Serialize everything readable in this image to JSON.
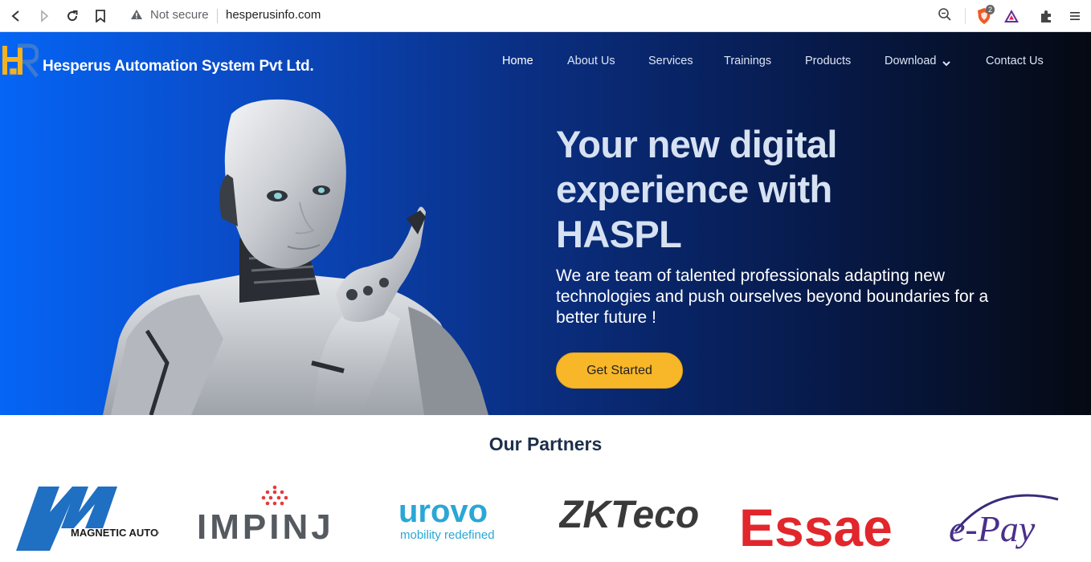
{
  "browser": {
    "security_label": "Not secure",
    "url": "hesperusinfo.com",
    "shield_badge": "2",
    "icons": [
      "back-icon",
      "forward-icon",
      "reload-icon",
      "bookmark-icon",
      "warning-icon",
      "zoom-icon",
      "brave-shield-icon",
      "brave-rewards-icon",
      "extensions-icon",
      "menu-icon"
    ]
  },
  "site": {
    "brand": "Hesperus Automation System Pvt Ltd.",
    "nav": [
      "Home",
      "About Us",
      "Services",
      "Trainings",
      "Products",
      "Download",
      "Contact Us"
    ],
    "active_nav": "Home"
  },
  "hero": {
    "headline": "Your new digital experience with HASPL",
    "subtitle": "We are team of talented professionals adapting new technologies and push ourselves beyond boundaries for a better future !",
    "cta": "Get Started"
  },
  "partners": {
    "title": "Our Partners",
    "logos": [
      {
        "name": "MAGNETIC AUTOCONTROL"
      },
      {
        "name": "IMPINJ"
      },
      {
        "name": "urovo",
        "tagline": "mobility redefined"
      },
      {
        "name": "ZKTeco"
      },
      {
        "name": "Essae"
      },
      {
        "name": "e-Pay"
      }
    ]
  },
  "colors": {
    "accent_button": "#f8b729",
    "hero_start": "#0565f5",
    "hero_end": "#050912",
    "partners_title": "#1d2f4a"
  }
}
